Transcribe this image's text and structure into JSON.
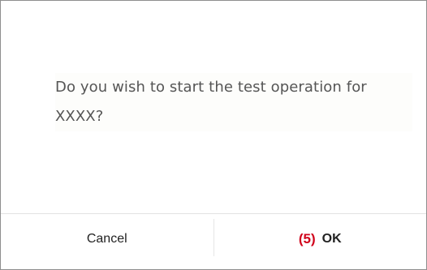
{
  "dialog": {
    "message": "Do you wish to start the test operation for XXXX?",
    "cancel_label": "Cancel",
    "ok_label": "OK",
    "step_annotation": "(5)"
  },
  "colors": {
    "annotation": "#d0021b",
    "text": "#555555",
    "border": "#8e8e8e"
  }
}
